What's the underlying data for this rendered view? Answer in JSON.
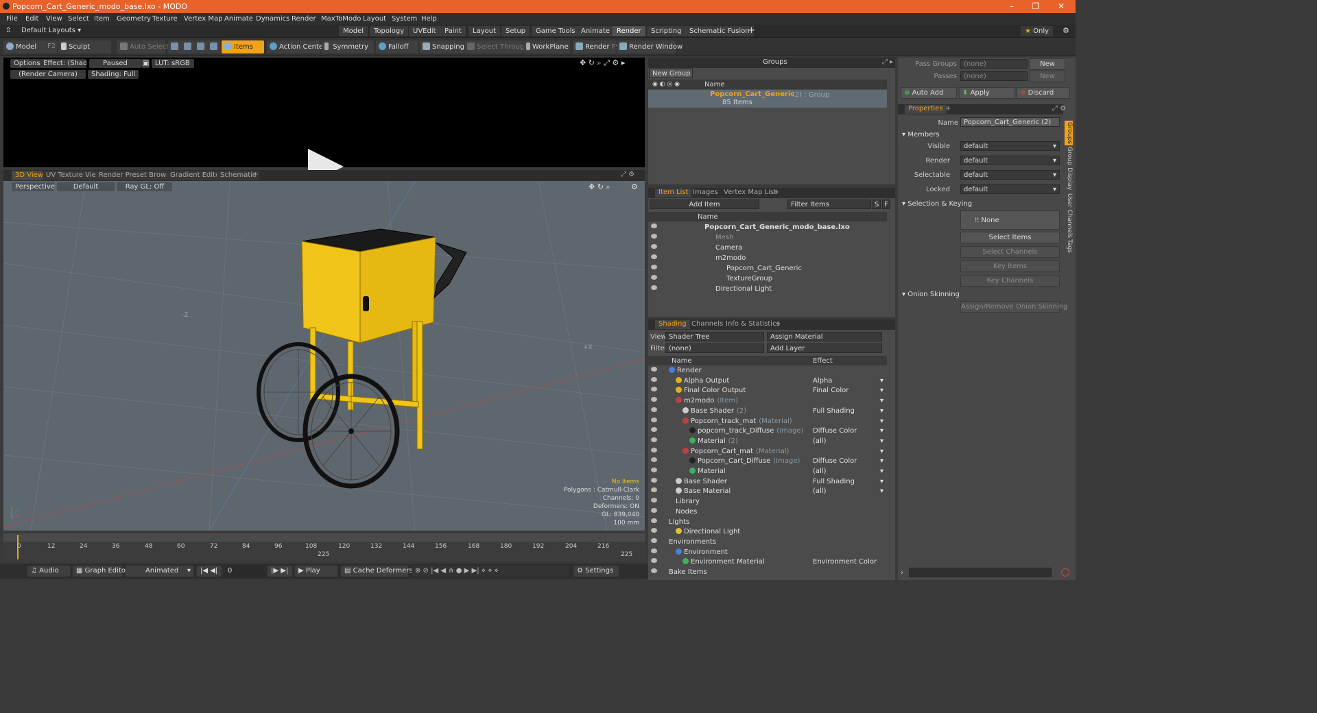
{
  "window": {
    "title": "Popcorn_Cart_Generic_modo_base.lxo - MODO"
  },
  "menu": [
    "File",
    "Edit",
    "View",
    "Select",
    "Item",
    "Geometry",
    "Texture",
    "Vertex Map",
    "Animate",
    "Dynamics",
    "Render",
    "MaxToModo",
    "Layout",
    "System",
    "Help"
  ],
  "layoutbar": {
    "layout": "Default Layouts",
    "tabs": [
      "Model",
      "Topology",
      "UVEdit",
      "Paint",
      "Layout",
      "Setup",
      "Game Tools",
      "Animate",
      "Render",
      "Scripting",
      "Schematic Fusion"
    ],
    "active": "Render",
    "only": "Only"
  },
  "toolbar": {
    "model": "Model",
    "model_key": "F2",
    "sculpt": "Sculpt",
    "auto_select": "Auto Select",
    "items": "Items",
    "action_center": "Action Center",
    "symmetry": "Symmetry",
    "falloff": "Falloff",
    "snapping": "Snapping",
    "select_through": "Select Through",
    "workplane": "WorkPlane",
    "render": "Render",
    "render_key": "F9",
    "render_window": "Render Window"
  },
  "render_view": {
    "options": "Options",
    "effect": "Effect: (Shadi...",
    "paused": "Paused",
    "lut": "LUT: sRGB",
    "camera": "(Render Camera)",
    "shading": "Shading: Full"
  },
  "viewport_tabs": [
    "3D View",
    "UV Texture View",
    "Render Preset Browser",
    "Gradient Editor",
    "Schematic"
  ],
  "viewport": {
    "projection": "Perspective",
    "style": "Default",
    "raygl": "Ray GL: Off",
    "axis_z": "-Z",
    "axis_x": "+X"
  },
  "viewport_info": [
    "No Items",
    "Polygons : Catmull-Clark",
    "Channels: 0",
    "Deformers: ON",
    "GL: 839,040",
    "100 mm"
  ],
  "timeline": {
    "ticks": [
      "0",
      "12",
      "24",
      "36",
      "48",
      "60",
      "72",
      "84",
      "96",
      "108",
      "120",
      "132",
      "144",
      "156",
      "168",
      "180",
      "192",
      "204",
      "216"
    ],
    "marker": "225",
    "end": "225"
  },
  "bottom": {
    "audio": "Audio",
    "graph_editor": "Graph Editor",
    "animated": "Animated",
    "frame": "0",
    "play": "Play",
    "cache": "Cache Deformers",
    "settings": "Settings"
  },
  "groups": {
    "title": "Groups",
    "new_group": "New Group",
    "col_name": "Name",
    "item_name": "Popcorn_Cart_Generic",
    "item_suffix": "(2) : Group",
    "item_count": "85 Items"
  },
  "itemlist": {
    "tabs": [
      "Item List",
      "Images",
      "Vertex Map List"
    ],
    "add_item": "Add Item",
    "filter": "Filter Items",
    "s": "S",
    "f": "F",
    "col_name": "Name",
    "rows": [
      {
        "label": "Popcorn_Cart_Generic_modo_base.lxo",
        "indent": 0,
        "bold": true
      },
      {
        "label": "Mesh",
        "indent": 1,
        "gray": true
      },
      {
        "label": "Camera",
        "indent": 1
      },
      {
        "label": "m2modo",
        "indent": 1
      },
      {
        "label": "Popcorn_Cart_Generic",
        "indent": 2
      },
      {
        "label": "TextureGroup",
        "indent": 2
      },
      {
        "label": "Directional Light",
        "indent": 1
      }
    ]
  },
  "shading": {
    "tabs": [
      "Shading",
      "Channels",
      "Info & Statistics"
    ],
    "view_label": "View",
    "view": "Shader Tree",
    "assign": "Assign Material",
    "filter_label": "Filter",
    "filter": "(none)",
    "add_layer": "Add Layer",
    "col_name": "Name",
    "col_effect": "Effect",
    "rows": [
      {
        "name": "Render",
        "suffix": "",
        "effect": "",
        "indent": 0,
        "color": "#4a7fd4"
      },
      {
        "name": "Alpha Output",
        "suffix": "",
        "effect": "Alpha",
        "indent": 1,
        "color": "#e0b020"
      },
      {
        "name": "Final Color Output",
        "suffix": "",
        "effect": "Final Color",
        "indent": 1,
        "color": "#e0b020"
      },
      {
        "name": "m2modo",
        "suffix": "(Item)",
        "effect": "",
        "indent": 1,
        "color": "#c04040"
      },
      {
        "name": "Base Shader",
        "suffix": "(2)",
        "effect": "Full Shading",
        "indent": 2,
        "color": "#cccccc"
      },
      {
        "name": "Popcorn_track_mat",
        "suffix": "(Material)",
        "effect": "",
        "indent": 2,
        "color": "#c04040"
      },
      {
        "name": "popcorn_track_Diffuse",
        "suffix": "(Image)",
        "effect": "Diffuse Color",
        "indent": 3,
        "color": "#222222"
      },
      {
        "name": "Material",
        "suffix": "(2)",
        "effect": "(all)",
        "indent": 3,
        "color": "#40b060"
      },
      {
        "name": "Popcorn_Cart_mat",
        "suffix": "(Material)",
        "effect": "",
        "indent": 2,
        "color": "#c04040"
      },
      {
        "name": "Popcorn_Cart_Diffuse",
        "suffix": "(Image)",
        "effect": "Diffuse Color",
        "indent": 3,
        "color": "#222222"
      },
      {
        "name": "Material",
        "suffix": "",
        "effect": "(all)",
        "indent": 3,
        "color": "#40b060"
      },
      {
        "name": "Base Shader",
        "suffix": "",
        "effect": "Full Shading",
        "indent": 1,
        "color": "#cccccc"
      },
      {
        "name": "Base Material",
        "suffix": "",
        "effect": "(all)",
        "indent": 1,
        "color": "#cccccc"
      },
      {
        "name": "Library",
        "suffix": "",
        "effect": "",
        "indent": 1,
        "color": ""
      },
      {
        "name": "Nodes",
        "suffix": "",
        "effect": "",
        "indent": 1,
        "color": ""
      },
      {
        "name": "Lights",
        "suffix": "",
        "effect": "",
        "indent": 0,
        "color": ""
      },
      {
        "name": "Directional Light",
        "suffix": "",
        "effect": "",
        "indent": 1,
        "color": "#e0c040"
      },
      {
        "name": "Environments",
        "suffix": "",
        "effect": "",
        "indent": 0,
        "color": ""
      },
      {
        "name": "Environment",
        "suffix": "",
        "effect": "",
        "indent": 1,
        "color": "#4a7fd4"
      },
      {
        "name": "Environment Material",
        "suffix": "",
        "effect": "Environment Color",
        "indent": 2,
        "color": "#40b060"
      },
      {
        "name": "Bake Items",
        "suffix": "",
        "effect": "",
        "indent": 0,
        "color": ""
      }
    ]
  },
  "props": {
    "pass_groups_label": "Pass Groups",
    "pass_groups": "(none)",
    "passes_label": "Passes",
    "passes": "(none)",
    "new": "New",
    "auto_add": "Auto Add",
    "apply": "Apply",
    "discard": "Discard",
    "tab": "Properties",
    "name_label": "Name",
    "name": "Popcorn_Cart_Generic (2)",
    "members": "Members",
    "fields": [
      {
        "label": "Visible",
        "value": "default"
      },
      {
        "label": "Render",
        "value": "default"
      },
      {
        "label": "Selectable",
        "value": "default"
      },
      {
        "label": "Locked",
        "value": "default"
      }
    ],
    "selection": "Selection & Keying",
    "none": "None",
    "select_items": "Select Items",
    "select_channels": "Select Channels",
    "key_items": "Key Items",
    "key_channels": "Key Channels",
    "onion": "Onion Skinning",
    "onion_btn": "Assign/Remove Onion Skinning",
    "sidetabs": [
      "Groups",
      "Group Display",
      "User Channels",
      "Tags"
    ]
  }
}
